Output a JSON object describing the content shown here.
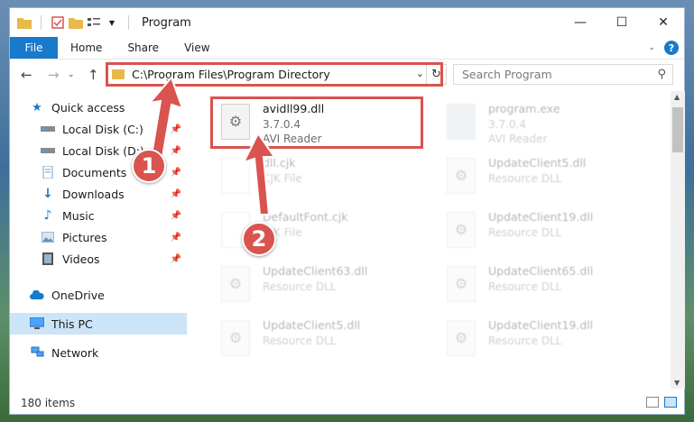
{
  "window": {
    "title": "Program",
    "controls": [
      "—",
      "☐",
      "✕"
    ]
  },
  "ribbon": {
    "file": "File",
    "tabs": [
      "Home",
      "Share",
      "View"
    ],
    "help": "?"
  },
  "address": {
    "path": "C:\\Program Files\\Program Directory",
    "dropdown": "⌄",
    "refresh": "↻"
  },
  "search": {
    "placeholder": "Search Program",
    "icon": "⚲"
  },
  "sidebar": {
    "quick_access": "Quick access",
    "items": [
      {
        "label": "Local Disk (C:)",
        "icon": "drive-icon"
      },
      {
        "label": "Local Disk (D:)",
        "icon": "drive-icon"
      },
      {
        "label": "Documents",
        "icon": "documents-icon"
      },
      {
        "label": "Downloads",
        "icon": "downloads-icon"
      },
      {
        "label": "Music",
        "icon": "music-icon"
      },
      {
        "label": "Pictures",
        "icon": "pictures-icon"
      },
      {
        "label": "Videos",
        "icon": "videos-icon"
      }
    ],
    "onedrive": "OneDrive",
    "this_pc": "This PC",
    "network": "Network"
  },
  "files": [
    {
      "name": "avidll99.dll",
      "version": "3.7.0.4",
      "desc": "AVI Reader"
    },
    {
      "name": "program.exe",
      "version": "3.7.0.4",
      "desc": "AVI Reader"
    },
    {
      "name": "dll.cjk",
      "desc": "CJK File"
    },
    {
      "name": "UpdateClient5.dll",
      "desc": "Resource DLL"
    },
    {
      "name": "DefaultFont.cjk",
      "desc": "CJK File"
    },
    {
      "name": "UpdateClient19.dll",
      "desc": "Resource DLL"
    },
    {
      "name": "UpdateClient63.dll",
      "desc": "Resource DLL"
    },
    {
      "name": "UpdateClient65.dll",
      "desc": "Resource DLL"
    },
    {
      "name": "UpdateClient5.dll",
      "desc": "Resource DLL"
    },
    {
      "name": "UpdateClient19.dll",
      "desc": "Resource DLL"
    }
  ],
  "status": {
    "count": "180 items"
  },
  "markers": [
    "1",
    "2"
  ],
  "colors": {
    "accent": "#1979ca",
    "highlight": "#d9534f",
    "folder": "#e8b84a"
  }
}
